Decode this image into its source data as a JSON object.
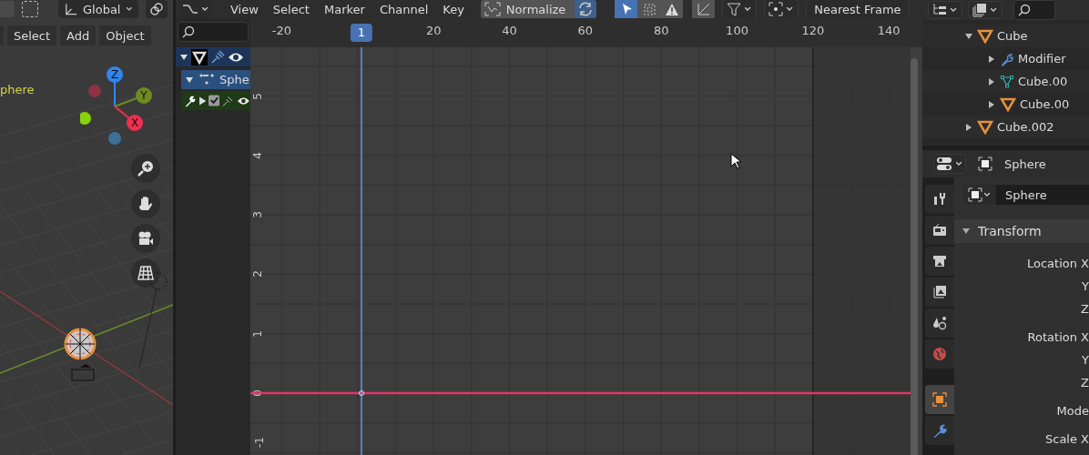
{
  "viewport": {
    "orientation": "Global",
    "menu": [
      "Select",
      "Add",
      "Object"
    ],
    "object_label": "phere",
    "gizmo_axes": [
      {
        "label": "Z",
        "color": "#2f86f0"
      },
      {
        "label": "Y",
        "color": "#6c8c22"
      },
      {
        "label": "X",
        "color": "#f0304e"
      }
    ]
  },
  "graph_editor": {
    "menu": [
      "View",
      "Select",
      "Marker",
      "Channel",
      "Key"
    ],
    "normalize": {
      "label": "Normalize",
      "on": false
    },
    "auto_normalize": {
      "on": true
    },
    "tools": [
      {
        "kind": "select",
        "selected": true
      },
      {
        "kind": "box",
        "selected": false
      },
      {
        "kind": "warning",
        "selected": false
      }
    ],
    "snapping": "Nearest Frame",
    "current_frame": "1",
    "frame_labels": [
      "-20",
      "20",
      "40",
      "60",
      "80",
      "100",
      "120",
      "140"
    ],
    "value_labels": [
      "5",
      "4",
      "3",
      "2",
      "1",
      "0",
      "-1"
    ],
    "channels": [
      {
        "kind": "object",
        "expanded": true
      },
      {
        "kind": "action",
        "label": "Sphe",
        "expanded": true
      },
      {
        "kind": "modifier",
        "checked": true
      }
    ]
  },
  "outliner": {
    "tree": [
      {
        "label": "Cube",
        "kind": "object",
        "expanded": true,
        "children": [
          {
            "label": "Modifier",
            "kind": "modifier",
            "expanded": false
          },
          {
            "label": "Cube.00",
            "kind": "mesh",
            "expanded": false
          },
          {
            "label": "Cube.00",
            "kind": "object",
            "expanded": false
          }
        ]
      },
      {
        "label": "Cube.002",
        "kind": "object",
        "expanded": false
      }
    ]
  },
  "properties": {
    "object_name": "Sphere",
    "name_field": "Sphere",
    "tabs": [
      {
        "kind": "tool",
        "selected": false
      },
      {
        "kind": "render",
        "selected": false
      },
      {
        "kind": "output",
        "selected": false
      },
      {
        "kind": "view_layer",
        "selected": false
      },
      {
        "kind": "scene",
        "selected": false
      },
      {
        "kind": "world",
        "selected": false
      },
      {
        "kind": "object",
        "selected": true
      },
      {
        "kind": "modifier",
        "selected": false
      }
    ],
    "panel": {
      "title": "Transform",
      "expanded": true,
      "rows": [
        {
          "label": "Location X"
        },
        {
          "label": "Y"
        },
        {
          "label": "Z"
        },
        {
          "label": "Rotation X"
        },
        {
          "label": "Y"
        },
        {
          "label": "Z"
        },
        {
          "label": "Mode"
        },
        {
          "label": "Scale X"
        }
      ]
    }
  }
}
